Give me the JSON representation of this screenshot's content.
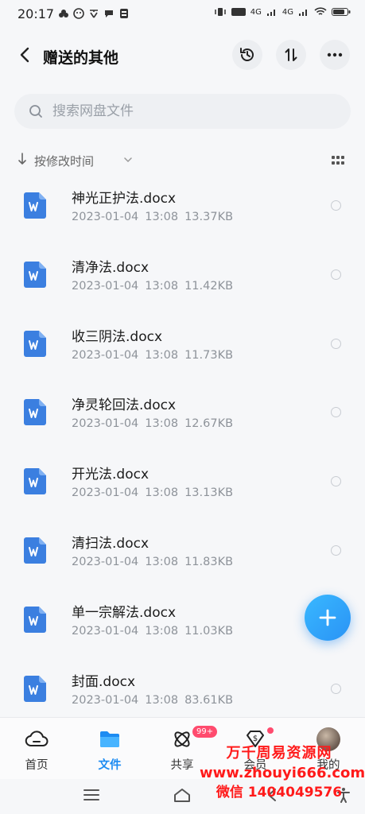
{
  "status_bar": {
    "time": "20:17",
    "network_1": "4G",
    "network_2": "4G"
  },
  "header": {
    "title": "赠送的其他",
    "back_icon": "chevron-left-icon",
    "history_icon": "history-clock-icon",
    "sort_icon": "swap-arrows-icon",
    "more_icon": "more-dots-icon"
  },
  "search": {
    "placeholder": "搜索网盘文件"
  },
  "sort": {
    "label": "按修改时间"
  },
  "files": [
    {
      "name": "神光正护法.docx",
      "date": "2023-01-04",
      "time": "13:08",
      "size": "13.37KB"
    },
    {
      "name": "清净法.docx",
      "date": "2023-01-04",
      "time": "13:08",
      "size": "11.42KB"
    },
    {
      "name": "收三阴法.docx",
      "date": "2023-01-04",
      "time": "13:08",
      "size": "11.73KB"
    },
    {
      "name": "净灵轮回法.docx",
      "date": "2023-01-04",
      "time": "13:08",
      "size": "12.67KB"
    },
    {
      "name": "开光法.docx",
      "date": "2023-01-04",
      "time": "13:08",
      "size": "13.13KB"
    },
    {
      "name": "清扫法.docx",
      "date": "2023-01-04",
      "time": "13:08",
      "size": "11.83KB"
    },
    {
      "name": "单一宗解法.docx",
      "date": "2023-01-04",
      "time": "13:08",
      "size": "11.03KB"
    },
    {
      "name": "封面.docx",
      "date": "2023-01-04",
      "time": "13:08",
      "size": "83.61KB"
    }
  ],
  "tabs": {
    "home": "首页",
    "files": "文件",
    "share": "共享",
    "share_badge": "99+",
    "vip": "会员",
    "mine": "我的"
  },
  "watermark": {
    "line1": "万千周易资源网",
    "line2": "www.zhouyi666.com",
    "line3": "微信 1404049576"
  },
  "colors": {
    "accent": "#1d8cf2",
    "word_icon": "#3b7fe0",
    "badge": "#ff4b6e",
    "watermark": "#ff1a1a"
  }
}
